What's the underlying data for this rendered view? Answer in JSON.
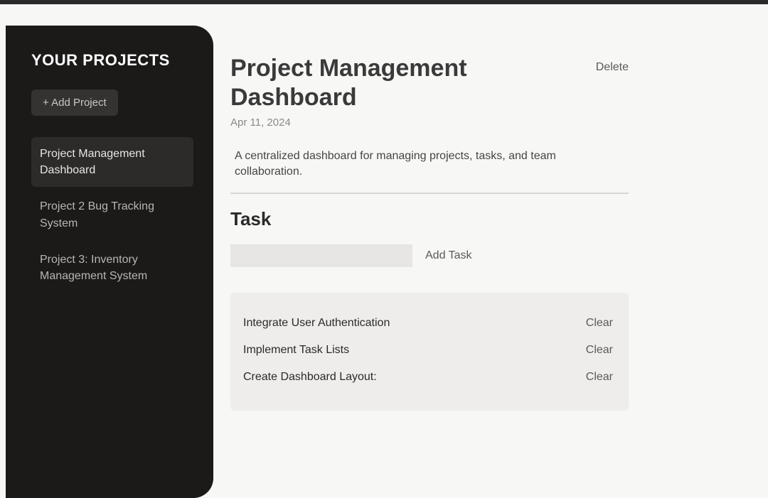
{
  "sidebar": {
    "title": "YOUR PROJECTS",
    "addButton": "+ Add Project",
    "projects": [
      {
        "name": "Project Management Dashboard",
        "active": true
      },
      {
        "name": "Project 2 Bug Tracking System",
        "active": false
      },
      {
        "name": "Project 3: Inventory Management System",
        "active": false
      }
    ]
  },
  "project": {
    "title": "Project Management Dashboard",
    "deleteLabel": "Delete",
    "date": "Apr 11, 2024",
    "description": "A centralized dashboard for managing projects, tasks, and team collaboration."
  },
  "taskSection": {
    "title": "Task",
    "addTaskLabel": "Add Task",
    "inputValue": "",
    "tasks": [
      {
        "label": "Integrate User Authentication",
        "clearLabel": "Clear"
      },
      {
        "label": "Implement Task Lists",
        "clearLabel": "Clear"
      },
      {
        "label": "Create Dashboard Layout:",
        "clearLabel": "Clear"
      }
    ]
  }
}
